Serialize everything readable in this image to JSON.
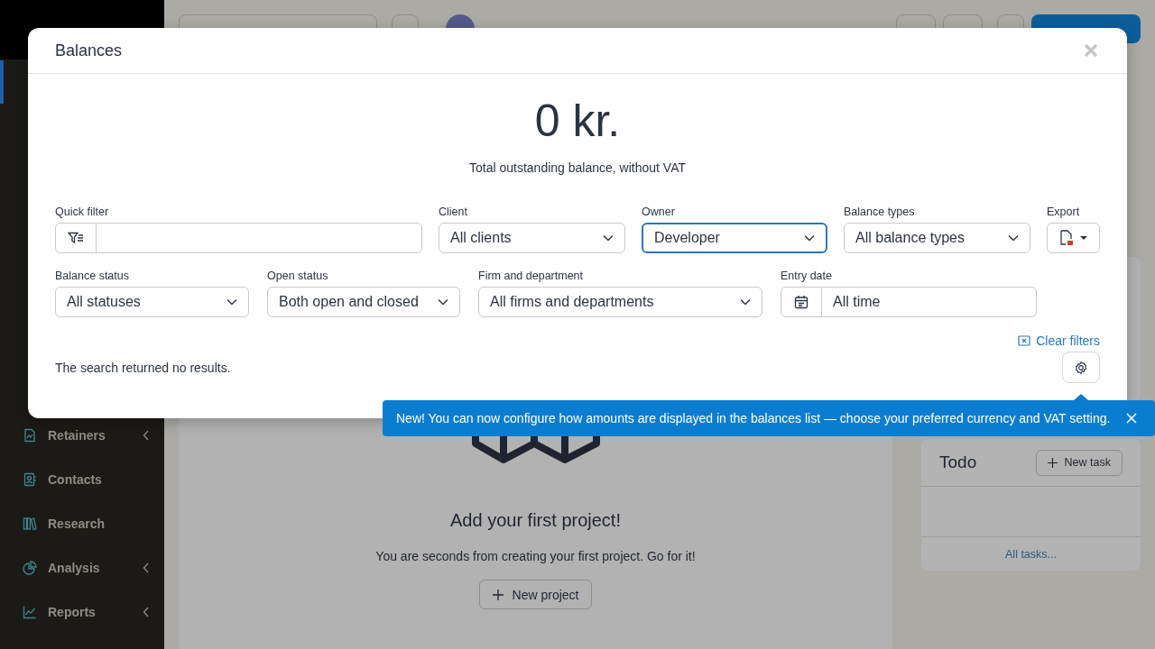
{
  "sidebar": {
    "items": [
      {
        "label": "Retainers",
        "expandable": true
      },
      {
        "label": "Contacts",
        "expandable": false
      },
      {
        "label": "Research",
        "expandable": false
      },
      {
        "label": "Analysis",
        "expandable": true
      },
      {
        "label": "Reports",
        "expandable": true
      }
    ]
  },
  "project_card": {
    "heading": "Add your first project!",
    "text": "You are seconds from creating your first project. Go for it!",
    "button": "New project"
  },
  "todo": {
    "title": "Todo",
    "new_task_button": "New task",
    "all_tasks_link": "All tasks..."
  },
  "modal": {
    "title": "Balances",
    "amount": "0 kr.",
    "amount_caption": "Total outstanding balance, without VAT",
    "filters": [
      [
        {
          "kind": "quick",
          "label": "Quick filter",
          "focused": false
        },
        {
          "kind": "select",
          "label": "Client",
          "value": "All clients",
          "focused": false
        },
        {
          "kind": "select",
          "label": "Owner",
          "value": "Developer",
          "focused": true
        },
        {
          "kind": "select",
          "label": "Balance types",
          "value": "All balance types",
          "focused": false
        },
        {
          "kind": "export",
          "label": "Export"
        }
      ],
      [
        {
          "kind": "select",
          "label": "Balance status",
          "value": "All statuses",
          "focused": false
        },
        {
          "kind": "select",
          "label": "Open status",
          "value": "Both open and closed",
          "focused": false
        },
        {
          "kind": "select",
          "label": "Firm and department",
          "value": "All firms and departments",
          "focused": false
        },
        {
          "kind": "date",
          "label": "Entry date",
          "value": "All time",
          "focused": false
        }
      ]
    ],
    "clear_filters": "Clear filters",
    "empty_message": "The search returned no results."
  },
  "toast": {
    "text": "New! You can now configure how amounts are displayed in the balances list — choose your preferred currency and VAT setting."
  }
}
